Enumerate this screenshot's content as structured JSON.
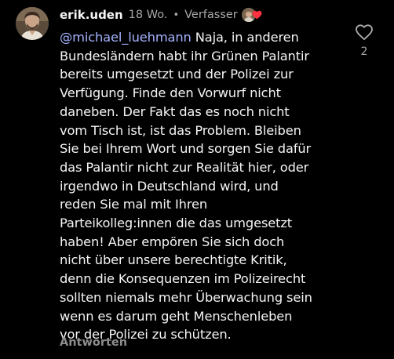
{
  "comment": {
    "username": "erik.uden",
    "time": "18 Wo.",
    "separator": "•",
    "author_label": "Verfasser",
    "mention": "@michael_luehmann",
    "lines": [
      " Naja, in anderen",
      "Bundesländern habt ihr Grünen Palantir",
      "bereits umgesetzt und der Polizei zur",
      "Verfügung. Finde den Vorwurf nicht",
      "daneben. Der Fakt das es noch nicht",
      "vom Tisch ist, ist das Problem. Bleiben",
      "Sie bei Ihrem Wort und sorgen Sie dafür",
      "das Palantir nicht zur Realität hier, oder",
      "irgendwo in Deutschland wird, und",
      "reden Sie mal mit Ihren",
      "Parteikolleg:innen die das umgesetzt",
      "haben! Aber empören Sie sich doch",
      "nicht über unsere berechtigte Kritik,",
      "denn die Konsequenzen im Polizeirecht",
      "sollten niemals mehr Überwachung sein",
      "wenn es darum geht Menschenleben",
      "vor der Polizei zu schützen."
    ],
    "reply_label": "Antworten",
    "like_count": "2",
    "icons": {
      "like": "heart-outline-icon",
      "author_liked": "heart-filled-icon"
    },
    "colors": {
      "background": "#000000",
      "text": "#f5f5f5",
      "secondary": "#a8a8a8",
      "mention": "#a5b3ff",
      "heart": "#ff3040"
    }
  }
}
